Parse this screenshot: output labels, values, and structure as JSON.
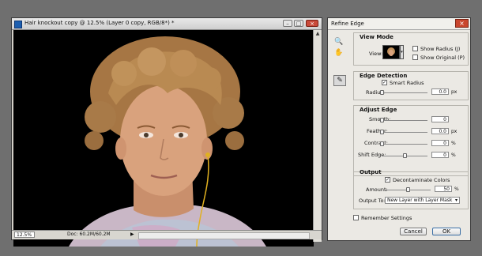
{
  "document": {
    "title": "Hair knockout copy @ 12.5% (Layer 0 copy, RGB/8*) *",
    "zoom": "12.5%",
    "doc_info": "Doc: 60.2M/60.2M",
    "window_buttons": [
      "–",
      "□",
      "×"
    ]
  },
  "dialog": {
    "title": "Refine Edge",
    "close_label": "×",
    "view_mode": {
      "header": "View Mode",
      "view_label": "View:",
      "show_radius": {
        "label": "Show Radius (J)",
        "checked": false
      },
      "show_original": {
        "label": "Show Original (P)",
        "checked": false
      }
    },
    "edge_detection": {
      "header": "Edge Detection",
      "smart_radius": {
        "label": "Smart Radius",
        "checked": true
      },
      "radius": {
        "label": "Radius:",
        "value": "0.0",
        "unit": "px",
        "level": 0
      }
    },
    "adjust_edge": {
      "header": "Adjust Edge",
      "smooth": {
        "label": "Smooth:",
        "value": "0",
        "unit": "",
        "level": 0
      },
      "feather": {
        "label": "Feather:",
        "value": "0.0",
        "unit": "px",
        "level": 0
      },
      "contrast": {
        "label": "Contrast:",
        "value": "0",
        "unit": "%",
        "level": 0
      },
      "shift_edge": {
        "label": "Shift Edge:",
        "value": "0",
        "unit": "%",
        "level": 0.5
      }
    },
    "output": {
      "header": "Output",
      "decontaminate": {
        "label": "Decontaminate Colors",
        "checked": true
      },
      "amount": {
        "label": "Amount:",
        "value": "50",
        "unit": "%",
        "level": 0.5
      },
      "output_to": {
        "label": "Output To:",
        "value": "New Layer with Layer Mask"
      }
    },
    "remember": {
      "label": "Remember Settings",
      "checked": false
    },
    "cancel_label": "Cancel",
    "ok_label": "OK"
  },
  "colors": {
    "hair": "#b98a52",
    "skin": "#d8a27c",
    "shirt": "#c8b4c4",
    "earphone": "#e0b020",
    "accent": "#3a6ea5"
  }
}
